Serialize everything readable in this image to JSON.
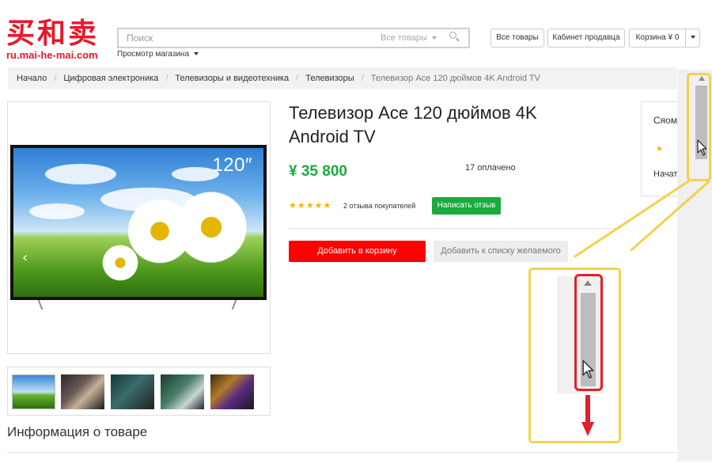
{
  "logo": {
    "chinese": "买和卖",
    "url": "ru.mai-he-mai.com"
  },
  "search": {
    "placeholder": "Поиск",
    "category": "Все товары"
  },
  "header": {
    "view_store": "Просмотр магазина",
    "all_products": "Все товары",
    "seller_cabinet": "Кабинет продавца",
    "cart": "Корзина ¥ 0"
  },
  "breadcrumb": [
    "Начало",
    "Цифровая электроника",
    "Телевизоры и видеотехника",
    "Телевизоры",
    "Телевизор Ace 120 дюймов 4K Android TV"
  ],
  "product": {
    "title": "Телевизор Ace 120 дюймов 4K Android TV",
    "image_badge": "120″",
    "price": "¥ 35 800",
    "paid_count": "17 оплачено",
    "stars": "★★★★★",
    "rating": 5,
    "reviews_count": "2 отзыва покупателей",
    "write_review": "Написать отзыв",
    "add_to_cart": "Добавить в корзину",
    "add_to_wishlist": "Добавить к списку желаемого"
  },
  "info_title": "Информация о товаре",
  "side_panel": {
    "title": "Сяом",
    "star": "★",
    "start": "Начат"
  },
  "colors": {
    "brand_red": "#e8192c",
    "price_green": "#1aab3e",
    "cart_red": "#ff0000",
    "highlight_yellow": "#f2d24c",
    "annotation_red": "#e0202a"
  }
}
